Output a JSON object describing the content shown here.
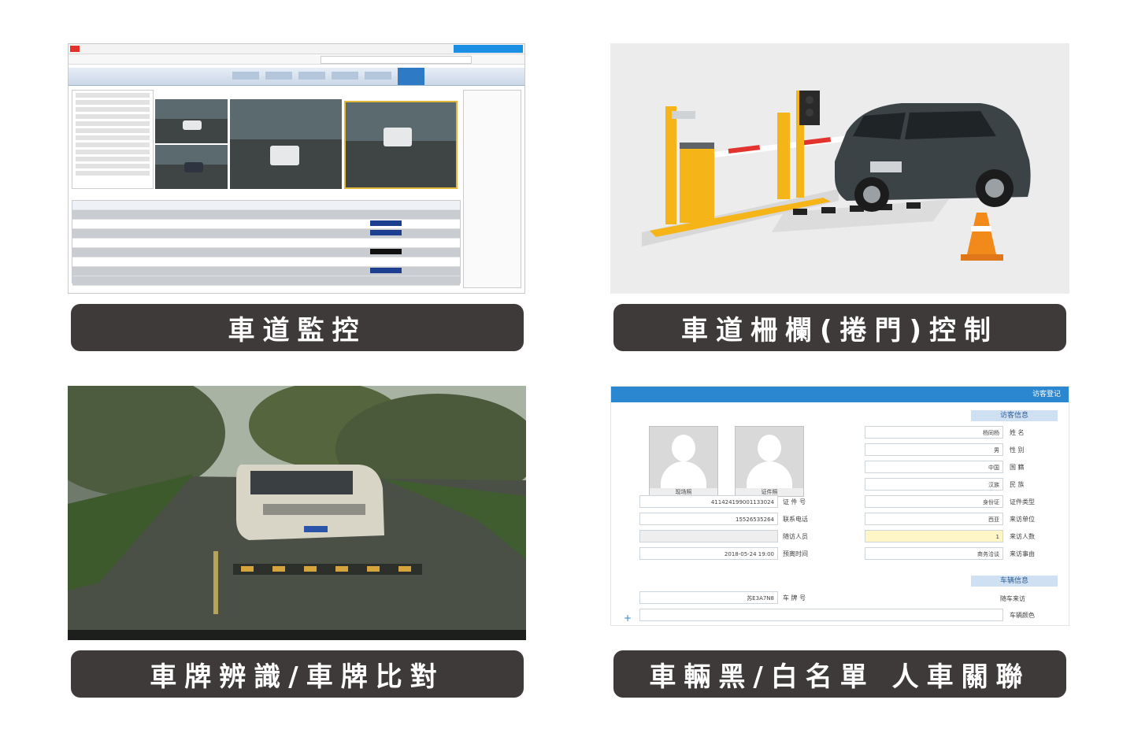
{
  "tiles": [
    {
      "caption": "車道監控"
    },
    {
      "caption": "車道柵欄(捲門)控制"
    },
    {
      "caption": "車牌辨識/車牌比對"
    },
    {
      "caption": "車輛黑/白名單 人車關聯"
    }
  ],
  "form": {
    "title": "访客登记",
    "section_visitor": "访客信息",
    "section_vehicle": "车辆信息",
    "photo1_label": "证件照",
    "photo2_label": "现场照",
    "right_fields": [
      {
        "label": "姓 名",
        "value": "杨同杨"
      },
      {
        "label": "性 别",
        "value": "男"
      },
      {
        "label": "国 籍",
        "value": "中国"
      },
      {
        "label": "民 族",
        "value": "汉族"
      },
      {
        "label": "证件类型",
        "value": "身份证"
      },
      {
        "label": "来访单位",
        "value": "西亚"
      },
      {
        "label": "来访人数",
        "value": "1"
      },
      {
        "label": "来访事由",
        "value": "商务洽谈"
      }
    ],
    "left_fields": [
      {
        "label": "证 件 号",
        "value": "411424199001133024"
      },
      {
        "label": "联系电话",
        "value": "15526535264"
      },
      {
        "label": "随访人员",
        "value": ""
      },
      {
        "label": "预离时间",
        "value": "2018-05-24 19:00"
      }
    ],
    "vehicle_fields": [
      {
        "label": "车 牌 号",
        "value": "苏E3A7N8"
      }
    ],
    "vehicle_checkbox": "随车来访",
    "vehicle_color_label": "车辆颜色"
  },
  "colors": {
    "caption_bg": "#3e3a39",
    "form_bar": "#2b87cf",
    "gate_yellow": "#f5b417",
    "car_dark": "#3c4347",
    "cone": "#f28a1a"
  }
}
